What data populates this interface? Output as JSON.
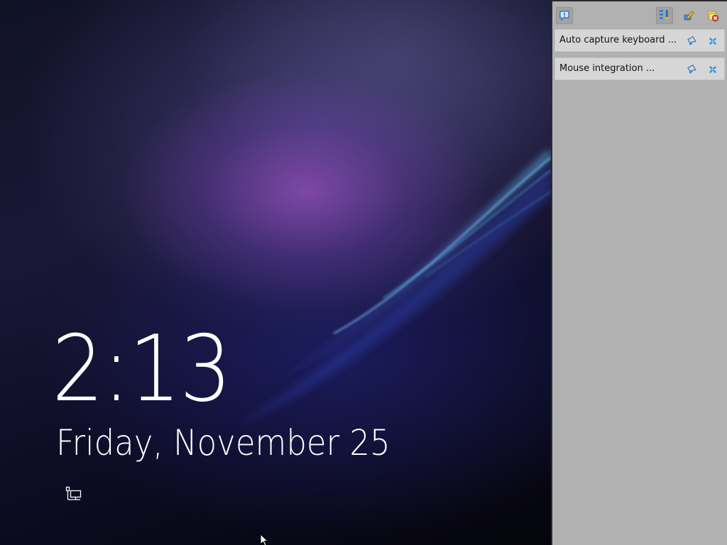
{
  "lockscreen": {
    "time": "2:13",
    "date": "Friday, November 25",
    "icons": {
      "network": "network-status-icon",
      "cursor": "mouse-cursor-icon"
    }
  },
  "notification_panel": {
    "toolbar": {
      "left_icon": "notification-info-icon",
      "right_icons": [
        "sort-order-icon",
        "edit-pencil-icon",
        "dismiss-all-icon"
      ]
    },
    "notices": [
      {
        "text": "Auto capture keyboard ...",
        "icons": [
          "pin-icon",
          "close-icon"
        ]
      },
      {
        "text": "Mouse integration ...",
        "icons": [
          "pin-icon",
          "close-icon"
        ]
      }
    ]
  },
  "colors": {
    "panel_bg": "#b1b1b1",
    "notice_bg": "#d6d6d6",
    "streak": "#5fc3f0",
    "clock_text": "#ffffff"
  }
}
